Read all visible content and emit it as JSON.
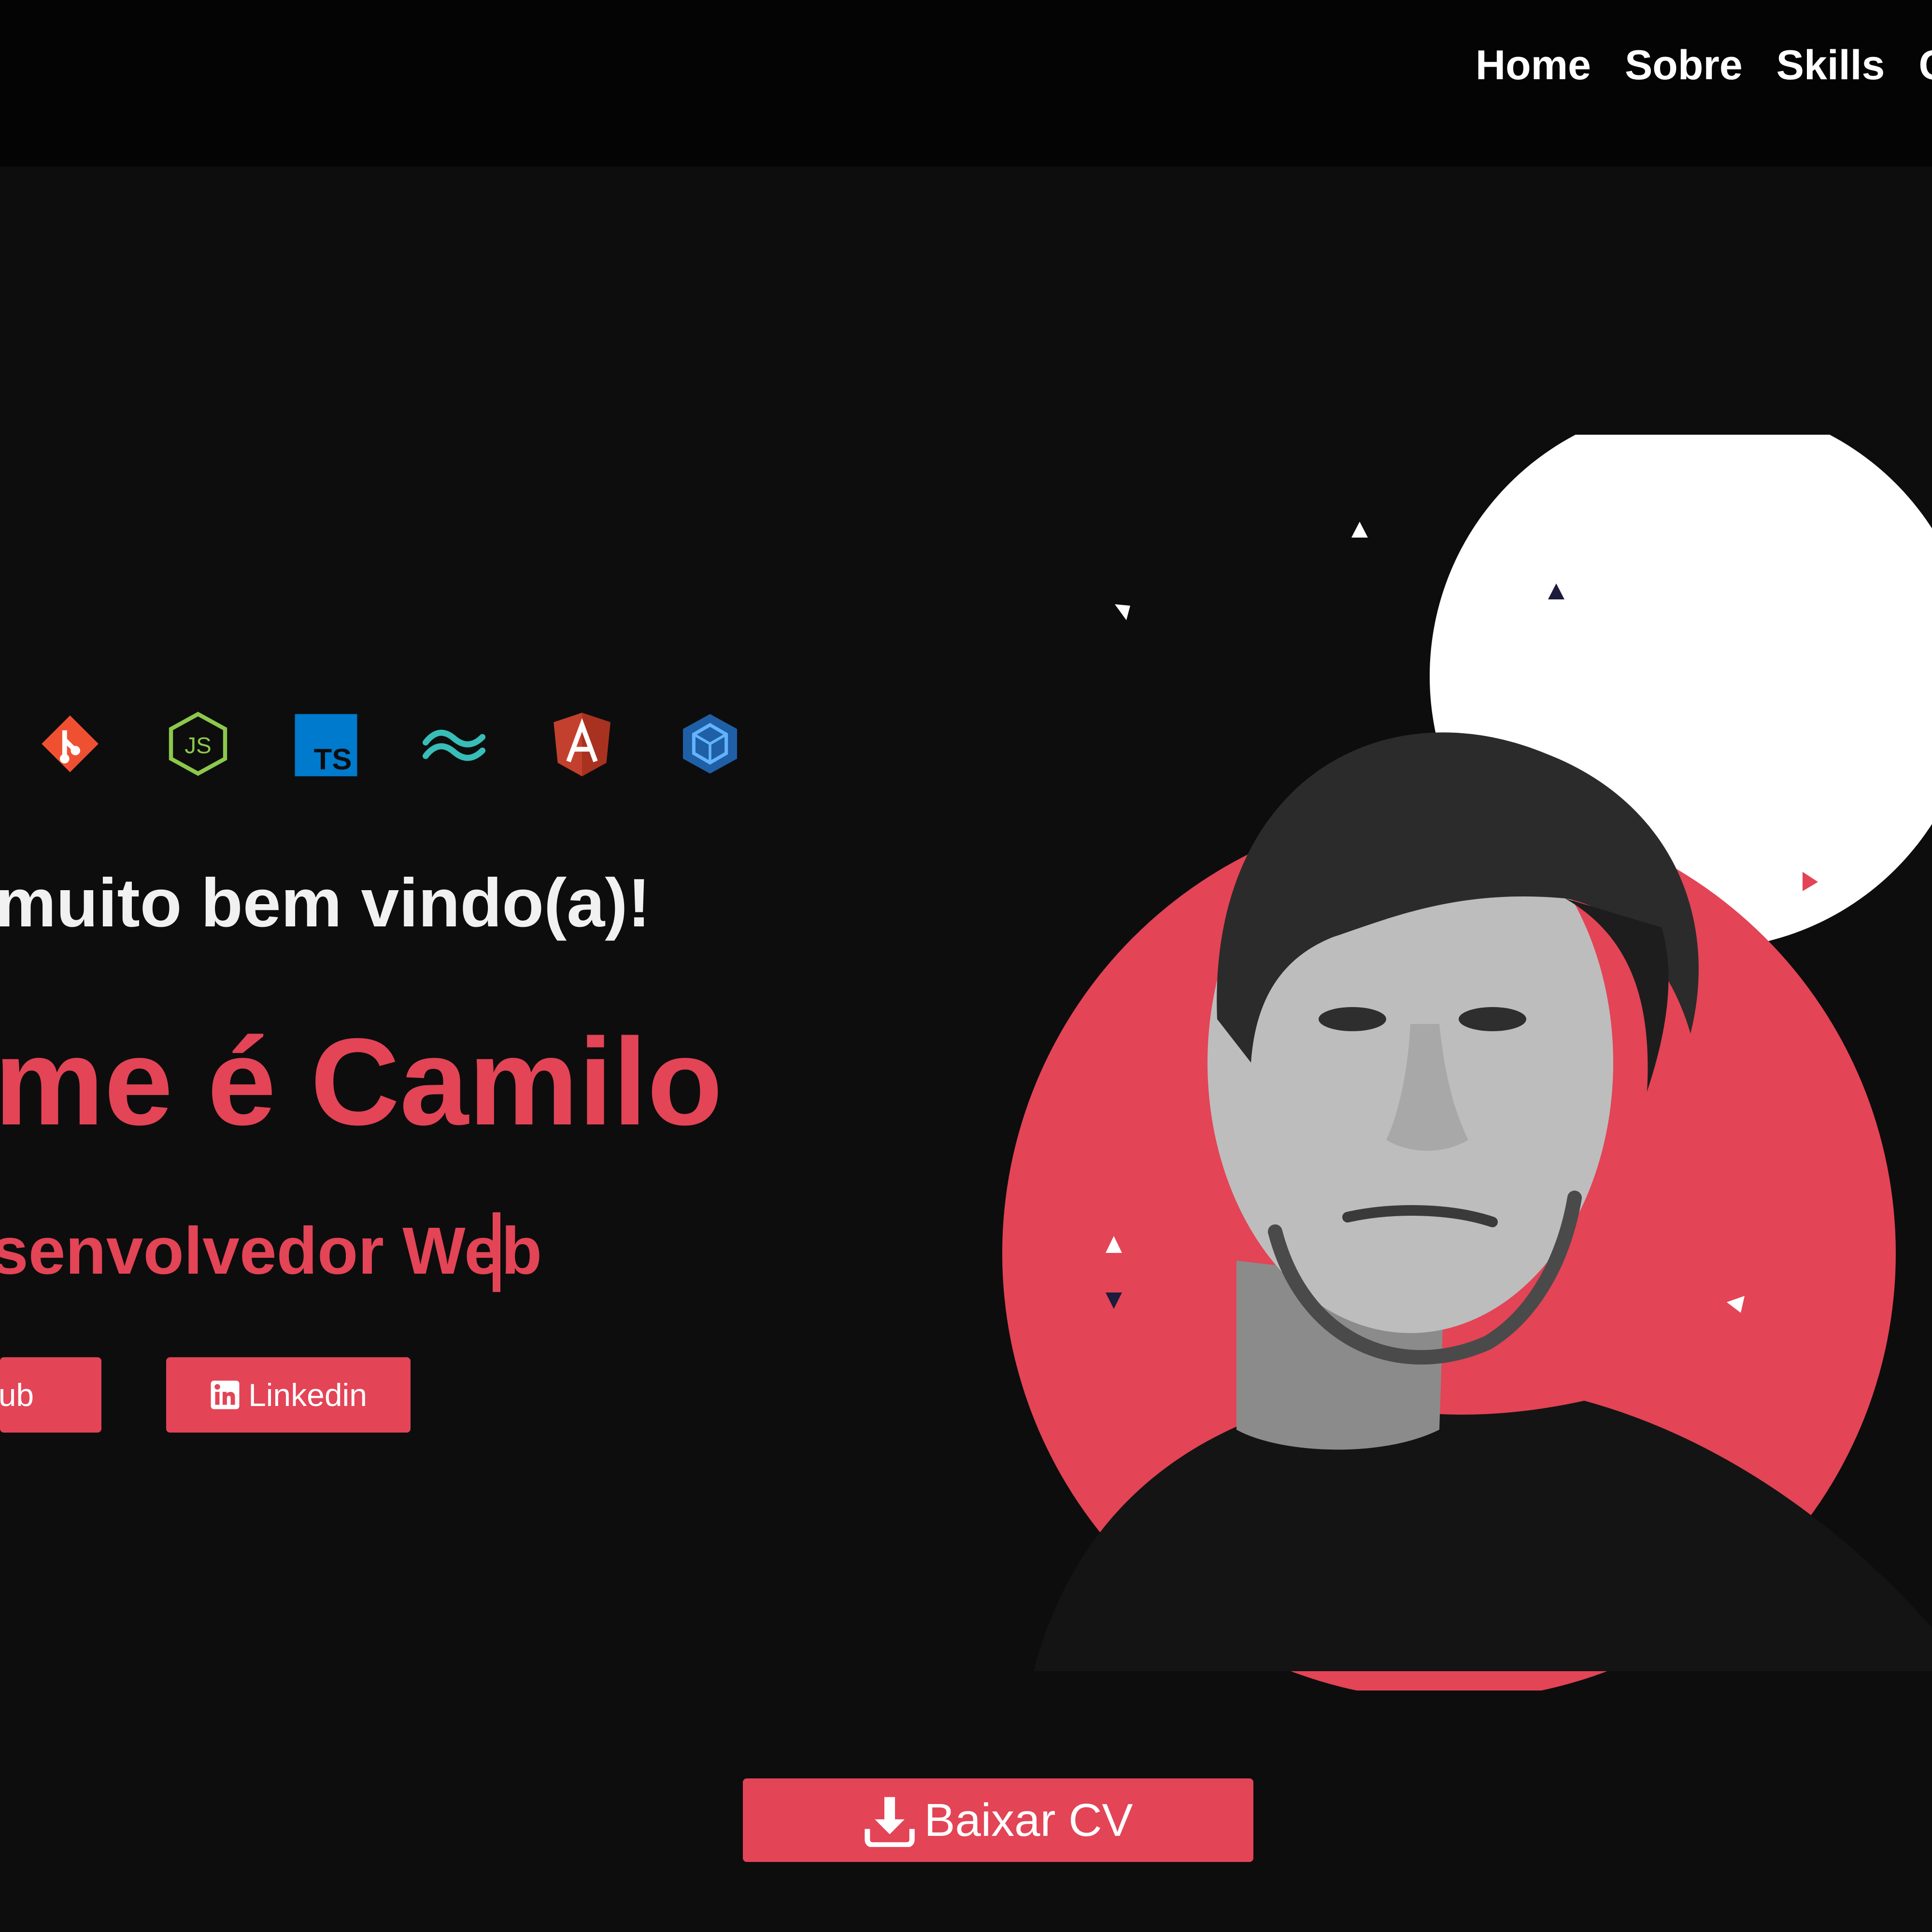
{
  "nav": {
    "items": [
      {
        "label": "Home"
      },
      {
        "label": "Sobre"
      },
      {
        "label": "Skills"
      },
      {
        "label": "C"
      }
    ]
  },
  "tech_icons": [
    "git-icon",
    "nodejs-icon",
    "typescript-icon",
    "tailwind-icon",
    "angular-icon",
    "sequelize-icon"
  ],
  "hero": {
    "welcome": "muito bem vindo(a)!",
    "name": "me é Camilo",
    "role": "senvolvedor Web"
  },
  "buttons": {
    "github_label": "hub",
    "linkedin_label": "Linkedin",
    "cv_label": "Baixar CV"
  },
  "colors": {
    "accent": "#e34456",
    "background": "#0d0d0e",
    "navbar": "#040405"
  }
}
